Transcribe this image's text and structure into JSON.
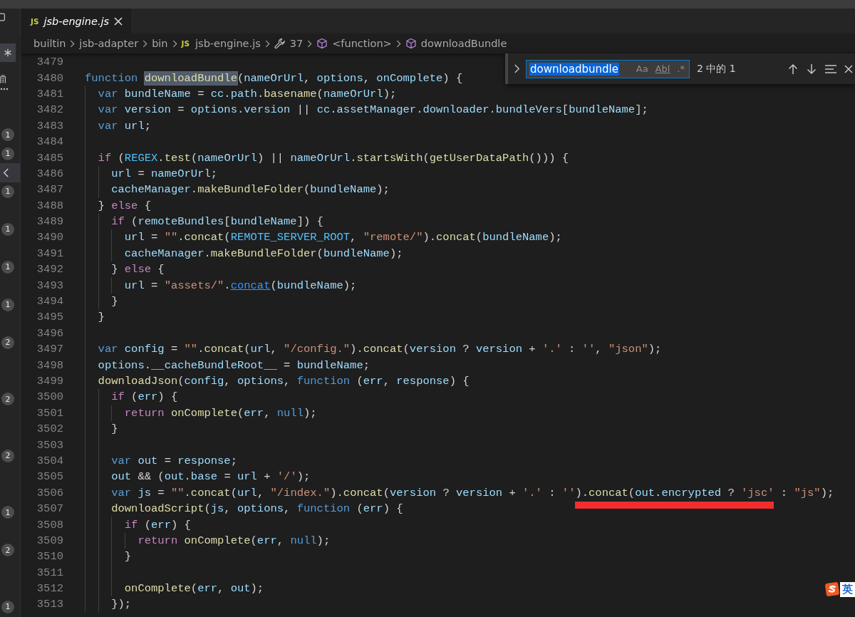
{
  "activity_rows": [
    {
      "kind": "badge",
      "text": "1",
      "selected": false
    },
    {
      "kind": "badge",
      "text": "1",
      "selected": false
    },
    {
      "kind": "chevron",
      "selected": true
    },
    {
      "kind": "badge",
      "text": "1",
      "selected": false
    },
    {
      "kind": "empty",
      "selected": false
    },
    {
      "kind": "badge",
      "text": "1",
      "selected": false
    },
    {
      "kind": "empty",
      "selected": false
    },
    {
      "kind": "badge",
      "text": "1",
      "selected": false
    },
    {
      "kind": "empty",
      "selected": false
    },
    {
      "kind": "badge",
      "text": "1",
      "selected": false
    },
    {
      "kind": "empty",
      "selected": false
    },
    {
      "kind": "badge",
      "text": "2",
      "selected": false
    },
    {
      "kind": "empty",
      "selected": false
    },
    {
      "kind": "empty",
      "selected": false
    },
    {
      "kind": "badge",
      "text": "2",
      "selected": false
    },
    {
      "kind": "empty",
      "selected": false
    },
    {
      "kind": "empty",
      "selected": false
    },
    {
      "kind": "badge",
      "text": "2",
      "selected": false
    },
    {
      "kind": "empty",
      "selected": false
    },
    {
      "kind": "empty",
      "selected": false
    },
    {
      "kind": "badge",
      "text": "1",
      "selected": false
    },
    {
      "kind": "empty",
      "selected": false
    },
    {
      "kind": "badge",
      "text": "2",
      "selected": false
    },
    {
      "kind": "empty",
      "selected": false
    },
    {
      "kind": "empty",
      "selected": false
    },
    {
      "kind": "badge",
      "text": "1",
      "selected": false
    }
  ],
  "tabs": [
    {
      "icon_text": "JS",
      "label": "jsb-engine.js",
      "selected": true,
      "preview": true
    }
  ],
  "breadcrumbs": [
    {
      "kind": "text",
      "label": "builtin"
    },
    {
      "kind": "text",
      "label": "jsb-adapter"
    },
    {
      "kind": "text",
      "label": "bin"
    },
    {
      "kind": "file",
      "icon_text": "JS",
      "label": "jsb-engine.js"
    },
    {
      "kind": "wrench",
      "label": "37"
    },
    {
      "kind": "cube",
      "label": "<function>"
    },
    {
      "kind": "cube",
      "label": "downloadBundle"
    }
  ],
  "find_widget": {
    "expanded": false,
    "value": "downloadbundle",
    "options": [
      {
        "label": "Aa",
        "on": false
      },
      {
        "label": "Abl",
        "on": false
      },
      {
        "label": ".*",
        "on": false
      }
    ],
    "match_count": "2 中的 1"
  },
  "code_lines": [
    {
      "number": "3479"
    },
    {
      "number": "3480",
      "tokens": [
        {
          "kind": "kw",
          "text": "function "
        },
        {
          "kind": "fn",
          "text": "downloadBundle",
          "search_match": true
        },
        {
          "kind": "p",
          "text": "("
        },
        {
          "kind": "v",
          "text": "nameOrUrl"
        },
        {
          "kind": "p",
          "text": ", "
        },
        {
          "kind": "v",
          "text": "options"
        },
        {
          "kind": "p",
          "text": ", "
        },
        {
          "kind": "v",
          "text": "onComplete"
        },
        {
          "kind": "p",
          "text": ") {"
        }
      ]
    },
    {
      "number": "3481",
      "tokens": [
        {
          "kind": "kw",
          "text": "  var "
        },
        {
          "kind": "v",
          "text": "bundleName"
        },
        {
          "kind": "p",
          "text": " = "
        },
        {
          "kind": "v",
          "text": "cc"
        },
        {
          "kind": "p",
          "text": "."
        },
        {
          "kind": "v",
          "text": "path"
        },
        {
          "kind": "p",
          "text": "."
        },
        {
          "kind": "fn",
          "text": "basename"
        },
        {
          "kind": "p",
          "text": "("
        },
        {
          "kind": "v",
          "text": "nameOrUrl"
        },
        {
          "kind": "p",
          "text": ");"
        }
      ]
    },
    {
      "number": "3482",
      "tokens": [
        {
          "kind": "kw",
          "text": "  var "
        },
        {
          "kind": "v",
          "text": "version"
        },
        {
          "kind": "p",
          "text": " = "
        },
        {
          "kind": "v",
          "text": "options"
        },
        {
          "kind": "p",
          "text": "."
        },
        {
          "kind": "v",
          "text": "version"
        },
        {
          "kind": "p",
          "text": " || "
        },
        {
          "kind": "v",
          "text": "cc"
        },
        {
          "kind": "p",
          "text": "."
        },
        {
          "kind": "v",
          "text": "assetManager"
        },
        {
          "kind": "p",
          "text": "."
        },
        {
          "kind": "v",
          "text": "downloader"
        },
        {
          "kind": "p",
          "text": "."
        },
        {
          "kind": "v",
          "text": "bundleVers"
        },
        {
          "kind": "p",
          "text": "["
        },
        {
          "kind": "v",
          "text": "bundleName"
        },
        {
          "kind": "p",
          "text": "];"
        }
      ]
    },
    {
      "number": "3483",
      "tokens": [
        {
          "kind": "kw",
          "text": "  var "
        },
        {
          "kind": "v",
          "text": "url"
        },
        {
          "kind": "p",
          "text": ";"
        }
      ]
    },
    {
      "number": "3484"
    },
    {
      "number": "3485",
      "tokens": [
        {
          "kind": "ctl",
          "text": "  if"
        },
        {
          "kind": "p",
          "text": " ("
        },
        {
          "kind": "c",
          "text": "REGEX"
        },
        {
          "kind": "p",
          "text": "."
        },
        {
          "kind": "fn",
          "text": "test"
        },
        {
          "kind": "p",
          "text": "("
        },
        {
          "kind": "v",
          "text": "nameOrUrl"
        },
        {
          "kind": "p",
          "text": ") || "
        },
        {
          "kind": "v",
          "text": "nameOrUrl"
        },
        {
          "kind": "p",
          "text": "."
        },
        {
          "kind": "fn",
          "text": "startsWith"
        },
        {
          "kind": "p",
          "text": "("
        },
        {
          "kind": "fn",
          "text": "getUserDataPath"
        },
        {
          "kind": "p",
          "text": "())) {"
        }
      ]
    },
    {
      "number": "3486",
      "tokens": [
        {
          "kind": "v",
          "text": "    url"
        },
        {
          "kind": "p",
          "text": " = "
        },
        {
          "kind": "v",
          "text": "nameOrUrl"
        },
        {
          "kind": "p",
          "text": ";"
        }
      ]
    },
    {
      "number": "3487",
      "tokens": [
        {
          "kind": "v",
          "text": "    cacheManager"
        },
        {
          "kind": "p",
          "text": "."
        },
        {
          "kind": "fn",
          "text": "makeBundleFolder"
        },
        {
          "kind": "p",
          "text": "("
        },
        {
          "kind": "v",
          "text": "bundleName"
        },
        {
          "kind": "p",
          "text": ");"
        }
      ]
    },
    {
      "number": "3488",
      "tokens": [
        {
          "kind": "p",
          "text": "  } "
        },
        {
          "kind": "ctl",
          "text": "else"
        },
        {
          "kind": "p",
          "text": " {"
        }
      ]
    },
    {
      "number": "3489",
      "tokens": [
        {
          "kind": "ctl",
          "text": "    if"
        },
        {
          "kind": "p",
          "text": " ("
        },
        {
          "kind": "v",
          "text": "remoteBundles"
        },
        {
          "kind": "p",
          "text": "["
        },
        {
          "kind": "v",
          "text": "bundleName"
        },
        {
          "kind": "p",
          "text": "]) {"
        }
      ]
    },
    {
      "number": "3490",
      "tokens": [
        {
          "kind": "v",
          "text": "      url"
        },
        {
          "kind": "p",
          "text": " = "
        },
        {
          "kind": "s",
          "text": "\"\""
        },
        {
          "kind": "p",
          "text": "."
        },
        {
          "kind": "fn",
          "text": "concat"
        },
        {
          "kind": "p",
          "text": "("
        },
        {
          "kind": "c",
          "text": "REMOTE_SERVER_ROOT"
        },
        {
          "kind": "p",
          "text": ", "
        },
        {
          "kind": "s",
          "text": "\"remote/\""
        },
        {
          "kind": "p",
          "text": ")."
        },
        {
          "kind": "fn",
          "text": "concat"
        },
        {
          "kind": "p",
          "text": "("
        },
        {
          "kind": "v",
          "text": "bundleName"
        },
        {
          "kind": "p",
          "text": ");"
        }
      ]
    },
    {
      "number": "3491",
      "tokens": [
        {
          "kind": "v",
          "text": "      cacheManager"
        },
        {
          "kind": "p",
          "text": "."
        },
        {
          "kind": "fn",
          "text": "makeBundleFolder"
        },
        {
          "kind": "p",
          "text": "("
        },
        {
          "kind": "v",
          "text": "bundleName"
        },
        {
          "kind": "p",
          "text": ");"
        }
      ]
    },
    {
      "number": "3492",
      "tokens": [
        {
          "kind": "p",
          "text": "    } "
        },
        {
          "kind": "ctl",
          "text": "else"
        },
        {
          "kind": "p",
          "text": " {"
        }
      ]
    },
    {
      "number": "3493",
      "tokens": [
        {
          "kind": "v",
          "text": "      url"
        },
        {
          "kind": "p",
          "text": " = "
        },
        {
          "kind": "s",
          "text": "\"assets/\""
        },
        {
          "kind": "p",
          "text": "."
        },
        {
          "kind": "fn",
          "text": "concat",
          "link": true
        },
        {
          "kind": "p",
          "text": "("
        },
        {
          "kind": "v",
          "text": "bundleName"
        },
        {
          "kind": "p",
          "text": ");"
        }
      ]
    },
    {
      "number": "3494",
      "tokens": [
        {
          "kind": "p",
          "text": "    }"
        }
      ]
    },
    {
      "number": "3495",
      "tokens": [
        {
          "kind": "p",
          "text": "  }"
        }
      ]
    },
    {
      "number": "3496"
    },
    {
      "number": "3497",
      "tokens": [
        {
          "kind": "kw",
          "text": "  var "
        },
        {
          "kind": "v",
          "text": "config"
        },
        {
          "kind": "p",
          "text": " = "
        },
        {
          "kind": "s",
          "text": "\"\""
        },
        {
          "kind": "p",
          "text": "."
        },
        {
          "kind": "fn",
          "text": "concat"
        },
        {
          "kind": "p",
          "text": "("
        },
        {
          "kind": "v",
          "text": "url"
        },
        {
          "kind": "p",
          "text": ", "
        },
        {
          "kind": "s",
          "text": "\"/config.\""
        },
        {
          "kind": "p",
          "text": ")."
        },
        {
          "kind": "fn",
          "text": "concat"
        },
        {
          "kind": "p",
          "text": "("
        },
        {
          "kind": "v",
          "text": "version"
        },
        {
          "kind": "p",
          "text": " ? "
        },
        {
          "kind": "v",
          "text": "version"
        },
        {
          "kind": "p",
          "text": " + "
        },
        {
          "kind": "s",
          "text": "'.'"
        },
        {
          "kind": "p",
          "text": " : "
        },
        {
          "kind": "s",
          "text": "''"
        },
        {
          "kind": "p",
          "text": ", "
        },
        {
          "kind": "s",
          "text": "\"json\""
        },
        {
          "kind": "p",
          "text": ");"
        }
      ]
    },
    {
      "number": "3498",
      "tokens": [
        {
          "kind": "v",
          "text": "  options"
        },
        {
          "kind": "p",
          "text": "."
        },
        {
          "kind": "v",
          "text": "__cacheBundleRoot__"
        },
        {
          "kind": "p",
          "text": " = "
        },
        {
          "kind": "v",
          "text": "bundleName"
        },
        {
          "kind": "p",
          "text": ";"
        }
      ]
    },
    {
      "number": "3499",
      "tokens": [
        {
          "kind": "fn",
          "text": "  downloadJson"
        },
        {
          "kind": "p",
          "text": "("
        },
        {
          "kind": "v",
          "text": "config"
        },
        {
          "kind": "p",
          "text": ", "
        },
        {
          "kind": "v",
          "text": "options"
        },
        {
          "kind": "p",
          "text": ", "
        },
        {
          "kind": "kw",
          "text": "function"
        },
        {
          "kind": "p",
          "text": " ("
        },
        {
          "kind": "v",
          "text": "err"
        },
        {
          "kind": "p",
          "text": ", "
        },
        {
          "kind": "v",
          "text": "response"
        },
        {
          "kind": "p",
          "text": ") {"
        }
      ]
    },
    {
      "number": "3500",
      "tokens": [
        {
          "kind": "ctl",
          "text": "    if"
        },
        {
          "kind": "p",
          "text": " ("
        },
        {
          "kind": "v",
          "text": "err"
        },
        {
          "kind": "p",
          "text": ") {"
        }
      ]
    },
    {
      "number": "3501",
      "tokens": [
        {
          "kind": "ctl",
          "text": "      return "
        },
        {
          "kind": "fn",
          "text": "onComplete"
        },
        {
          "kind": "p",
          "text": "("
        },
        {
          "kind": "v",
          "text": "err"
        },
        {
          "kind": "p",
          "text": ", "
        },
        {
          "kind": "kw",
          "text": "null"
        },
        {
          "kind": "p",
          "text": ");"
        }
      ]
    },
    {
      "number": "3502",
      "tokens": [
        {
          "kind": "p",
          "text": "    }"
        }
      ]
    },
    {
      "number": "3503"
    },
    {
      "number": "3504",
      "tokens": [
        {
          "kind": "kw",
          "text": "    var "
        },
        {
          "kind": "v",
          "text": "out"
        },
        {
          "kind": "p",
          "text": " = "
        },
        {
          "kind": "v",
          "text": "response"
        },
        {
          "kind": "p",
          "text": ";"
        }
      ]
    },
    {
      "number": "3505",
      "tokens": [
        {
          "kind": "v",
          "text": "    out"
        },
        {
          "kind": "p",
          "text": " && ("
        },
        {
          "kind": "v",
          "text": "out"
        },
        {
          "kind": "p",
          "text": "."
        },
        {
          "kind": "v",
          "text": "base"
        },
        {
          "kind": "p",
          "text": " = "
        },
        {
          "kind": "v",
          "text": "url"
        },
        {
          "kind": "p",
          "text": " + "
        },
        {
          "kind": "s",
          "text": "'/'"
        },
        {
          "kind": "p",
          "text": ");"
        }
      ]
    },
    {
      "number": "3506",
      "tokens": [
        {
          "kind": "kw",
          "text": "    var "
        },
        {
          "kind": "v",
          "text": "js"
        },
        {
          "kind": "p",
          "text": " = "
        },
        {
          "kind": "s",
          "text": "\"\""
        },
        {
          "kind": "p",
          "text": "."
        },
        {
          "kind": "fn",
          "text": "concat"
        },
        {
          "kind": "p",
          "text": "("
        },
        {
          "kind": "v",
          "text": "url"
        },
        {
          "kind": "p",
          "text": ", "
        },
        {
          "kind": "s",
          "text": "\"/index.\""
        },
        {
          "kind": "p",
          "text": ")."
        },
        {
          "kind": "fn",
          "text": "concat"
        },
        {
          "kind": "p",
          "text": "("
        },
        {
          "kind": "v",
          "text": "version"
        },
        {
          "kind": "p",
          "text": " ? "
        },
        {
          "kind": "v",
          "text": "version"
        },
        {
          "kind": "p",
          "text": " + "
        },
        {
          "kind": "s",
          "text": "'.'"
        },
        {
          "kind": "p",
          "text": " : "
        },
        {
          "kind": "s",
          "text": "''"
        },
        {
          "kind": "group",
          "annotated": true,
          "tokens": [
            {
              "kind": "p",
              "text": ")."
            },
            {
              "kind": "fn",
              "text": "concat"
            },
            {
              "kind": "p",
              "text": "("
            },
            {
              "kind": "v",
              "text": "out"
            },
            {
              "kind": "p",
              "text": "."
            },
            {
              "kind": "v",
              "text": "encrypted"
            },
            {
              "kind": "p",
              "text": " ? "
            },
            {
              "kind": "s",
              "text": "'jsc'"
            }
          ]
        },
        {
          "kind": "p",
          "text": " : "
        },
        {
          "kind": "s",
          "text": "\"js\""
        },
        {
          "kind": "p",
          "text": ");"
        }
      ]
    },
    {
      "number": "3507",
      "tokens": [
        {
          "kind": "fn",
          "text": "    downloadScript"
        },
        {
          "kind": "p",
          "text": "("
        },
        {
          "kind": "v",
          "text": "js"
        },
        {
          "kind": "p",
          "text": ", "
        },
        {
          "kind": "v",
          "text": "options"
        },
        {
          "kind": "p",
          "text": ", "
        },
        {
          "kind": "kw",
          "text": "function"
        },
        {
          "kind": "p",
          "text": " ("
        },
        {
          "kind": "v",
          "text": "err"
        },
        {
          "kind": "p",
          "text": ") {"
        }
      ]
    },
    {
      "number": "3508",
      "tokens": [
        {
          "kind": "ctl",
          "text": "      if"
        },
        {
          "kind": "p",
          "text": " ("
        },
        {
          "kind": "v",
          "text": "err"
        },
        {
          "kind": "p",
          "text": ") {"
        }
      ]
    },
    {
      "number": "3509",
      "tokens": [
        {
          "kind": "ctl",
          "text": "        return "
        },
        {
          "kind": "fn",
          "text": "onComplete"
        },
        {
          "kind": "p",
          "text": "("
        },
        {
          "kind": "v",
          "text": "err"
        },
        {
          "kind": "p",
          "text": ", "
        },
        {
          "kind": "kw",
          "text": "null"
        },
        {
          "kind": "p",
          "text": ");"
        }
      ]
    },
    {
      "number": "3510",
      "tokens": [
        {
          "kind": "p",
          "text": "      }"
        }
      ]
    },
    {
      "number": "3511"
    },
    {
      "number": "3512",
      "tokens": [
        {
          "kind": "fn",
          "text": "      onComplete"
        },
        {
          "kind": "p",
          "text": "("
        },
        {
          "kind": "v",
          "text": "err"
        },
        {
          "kind": "p",
          "text": ", "
        },
        {
          "kind": "v",
          "text": "out"
        },
        {
          "kind": "p",
          "text": ");"
        }
      ]
    },
    {
      "number": "3513",
      "tokens": [
        {
          "kind": "p",
          "text": "    });"
        }
      ]
    }
  ],
  "ime_status": {
    "text": "英"
  }
}
